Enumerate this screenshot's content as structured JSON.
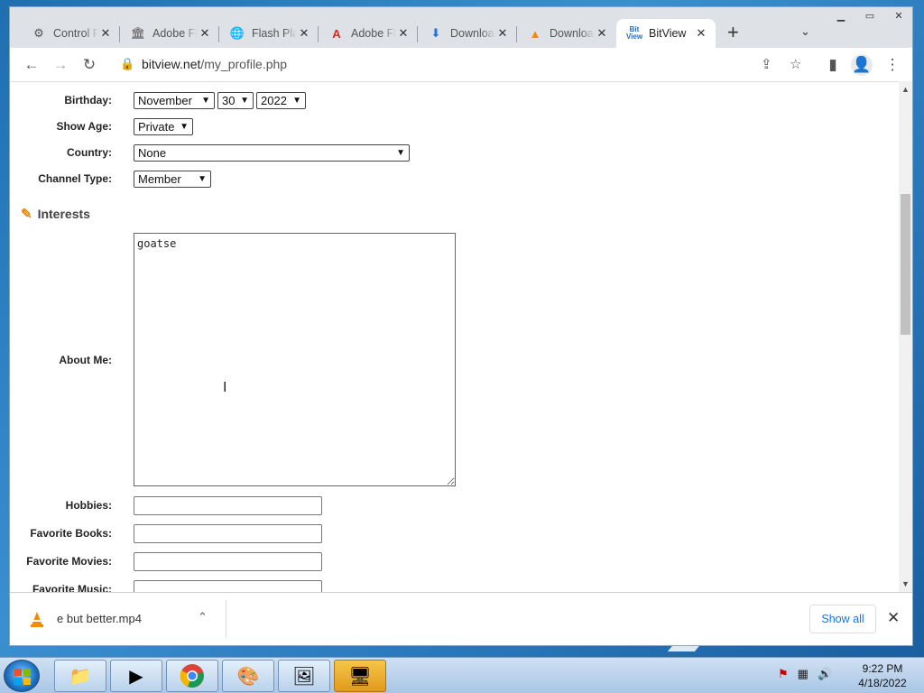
{
  "tabs": [
    {
      "title": "Control Panel",
      "icon": "control-panel-icon"
    },
    {
      "title": "Adobe Flash",
      "icon": "library-icon"
    },
    {
      "title": "Flash Player",
      "icon": "globe-icon"
    },
    {
      "title": "Adobe Flash",
      "icon": "adobe-icon"
    },
    {
      "title": "Downloads",
      "icon": "download-icon"
    },
    {
      "title": "Downloads",
      "icon": "vlc-icon"
    },
    {
      "title": "BitView",
      "icon": "bitview-icon",
      "active": true
    }
  ],
  "address": {
    "host": "bitview.net",
    "path": "/my_profile.php"
  },
  "form": {
    "birthday_label": "Birthday:",
    "birthday_month": "November",
    "birthday_day": "30",
    "birthday_year": "2022",
    "show_age_label": "Show Age:",
    "show_age_value": "Private",
    "country_label": "Country:",
    "country_value": "None",
    "channel_type_label": "Channel Type:",
    "channel_type_value": "Member",
    "interests_heading": "Interests",
    "about_me_label": "About Me:",
    "about_me_value": "goatse",
    "hobbies_label": "Hobbies:",
    "favorite_books_label": "Favorite Books:",
    "favorite_movies_label": "Favorite Movies:",
    "favorite_music_label": "Favorite Music:"
  },
  "downloads": {
    "file_name": "e but better.mp4",
    "show_all": "Show all"
  },
  "clock": {
    "time": "9:22 PM",
    "date": "4/18/2022"
  },
  "colors": {
    "accent": "#1a73e8",
    "pencil": "#e58a1a"
  }
}
